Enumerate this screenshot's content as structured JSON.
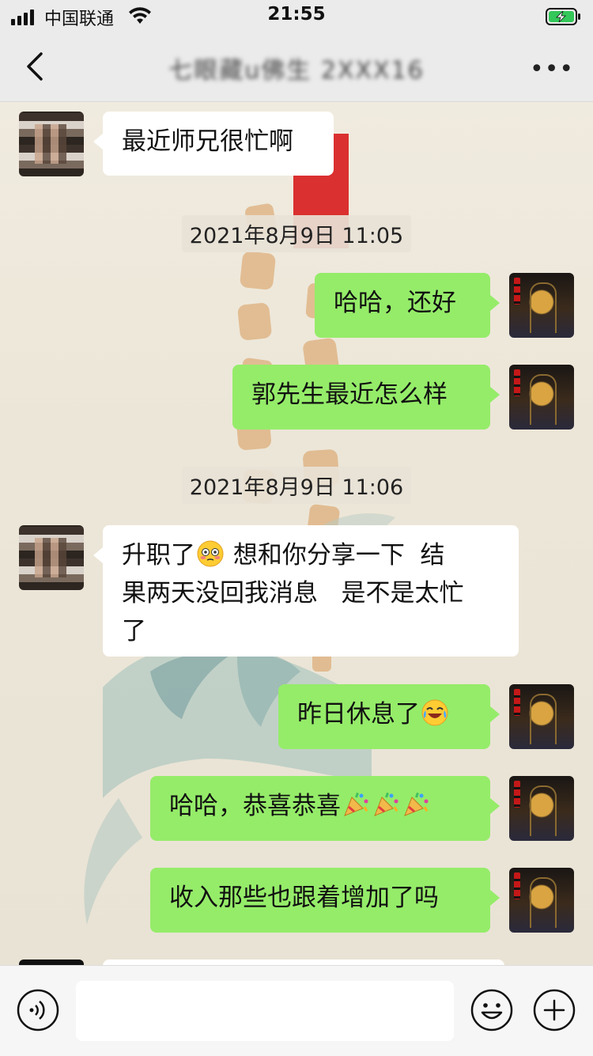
{
  "status_bar": {
    "carrier": "中国联通",
    "time": "21:55",
    "battery_state": "charging"
  },
  "nav": {
    "title": "七眼藏u佛生 2XXX16",
    "more_label": "•••"
  },
  "messages": [
    {
      "side": "left",
      "text": "最近师兄很忙啊"
    },
    {
      "type": "time",
      "text": "2021年8月9日 11:05"
    },
    {
      "side": "right",
      "text": "哈哈，还好"
    },
    {
      "side": "right",
      "text": "郭先生最近怎么样"
    },
    {
      "type": "time",
      "text": "2021年8月9日 11:06"
    },
    {
      "side": "left",
      "line1_a": "升职了",
      "line1_b": " 想和你分享一下  结",
      "line2": "果两天没回我消息   是不是太忙",
      "line3": "了",
      "emoji": "flushed-face"
    },
    {
      "side": "right",
      "text": "昨日休息了",
      "emoji": "tears-of-joy"
    },
    {
      "side": "right",
      "text": "哈哈，恭喜恭喜",
      "emoji": "party-popper x3"
    },
    {
      "side": "right",
      "text": "收入那些也跟着增加了吗"
    }
  ],
  "input_bar": {
    "voice_icon": "voice-icon",
    "emoji_icon": "emoji-icon",
    "plus_icon": "plus-icon",
    "value": ""
  },
  "colors": {
    "bubble_self": "#95ec69",
    "bubble_other": "#ffffff",
    "background": "#ece6d8"
  }
}
